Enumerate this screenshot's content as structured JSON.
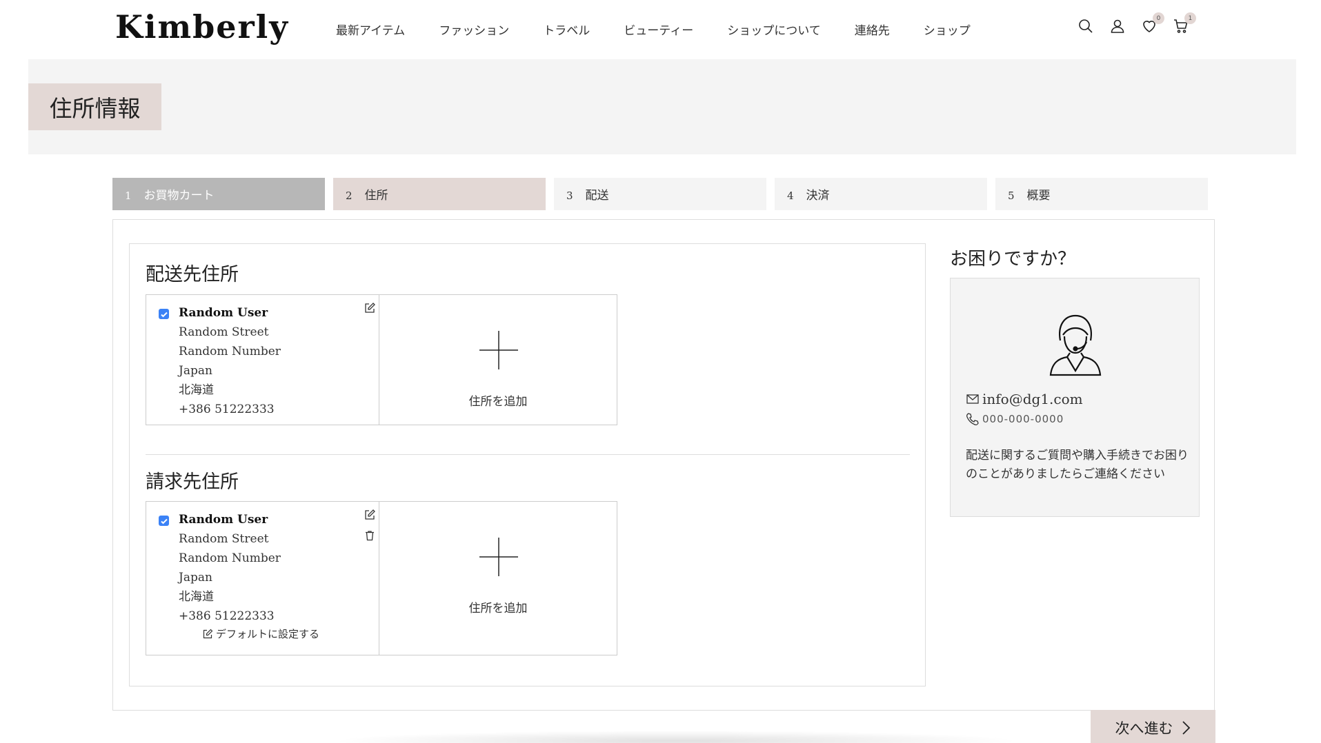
{
  "header": {
    "logo": "Kimberly",
    "nav": [
      "最新アイテム",
      "ファッション",
      "トラベル",
      "ビューティー",
      "ショップについて",
      "連絡先",
      "ショップ"
    ],
    "wishlist_count": "0",
    "cart_count": "1"
  },
  "banner": {
    "title": "住所情報"
  },
  "steps": [
    {
      "num": "1",
      "label": "お買物カート",
      "state": "done"
    },
    {
      "num": "2",
      "label": "住所",
      "state": "active"
    },
    {
      "num": "3",
      "label": "配送",
      "state": "upcoming"
    },
    {
      "num": "4",
      "label": "決済",
      "state": "upcoming"
    },
    {
      "num": "5",
      "label": "概要",
      "state": "upcoming"
    }
  ],
  "shipping": {
    "title": "配送先住所",
    "address": {
      "name": "Random User",
      "street": "Random Street",
      "number": "Random Number",
      "country": "Japan",
      "region": "北海道",
      "phone": "+386 51222333"
    },
    "add_label": "住所を追加"
  },
  "billing": {
    "title": "請求先住所",
    "address": {
      "name": "Random User",
      "street": "Random Street",
      "number": "Random Number",
      "country": "Japan",
      "region": "北海道",
      "phone": "+386 51222333"
    },
    "default_label": "デフォルトに設定する",
    "add_label": "住所を追加"
  },
  "help": {
    "title": "お困りですか？",
    "email": "info@dg1.com",
    "phone": "000-000-0000",
    "text": "配送に関するご質問や購入手続きでお困りのことがありましたらご連絡ください"
  },
  "next_button": "次へ進む",
  "colors": {
    "accent": "#e3d8d5",
    "done_step": "#b7b7b7",
    "checkbox": "#3b82f6",
    "panel": "#f4f4f4"
  }
}
